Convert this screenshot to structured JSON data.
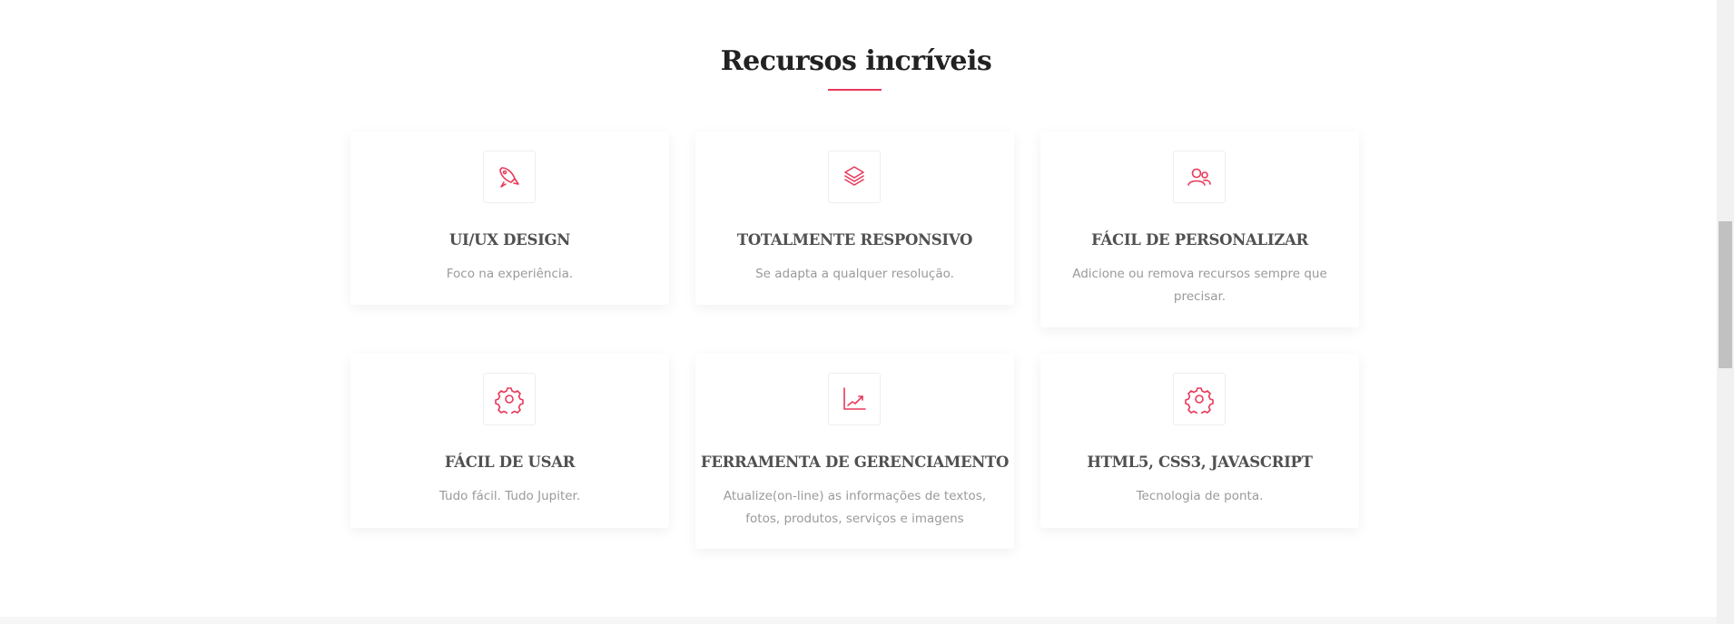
{
  "section": {
    "title": "Recursos incríveis",
    "accent_color": "#e8395a"
  },
  "features": [
    {
      "icon": "rocket-icon",
      "title": "UI/UX DESIGN",
      "description": "Foco na experiência."
    },
    {
      "icon": "layers-icon",
      "title": "TOTALMENTE RESPONSIVO",
      "description": "Se adapta a qualquer resolução."
    },
    {
      "icon": "users-icon",
      "title": "FÁCIL DE PERSONALIZAR",
      "description": "Adicione ou remova recursos sempre que precisar."
    },
    {
      "icon": "gear-icon",
      "title": "FÁCIL DE USAR",
      "description": "Tudo fácil. Tudo Jupiter."
    },
    {
      "icon": "chart-line-icon",
      "title": "FERRAMENTA DE GERENCIAMENTO",
      "description": "Atualize(on-line) as informações de textos, fotos, produtos, serviços e imagens"
    },
    {
      "icon": "gear-icon",
      "title": "HTML5, CSS3, JAVASCRIPT",
      "description": "Tecnologia de ponta."
    }
  ]
}
